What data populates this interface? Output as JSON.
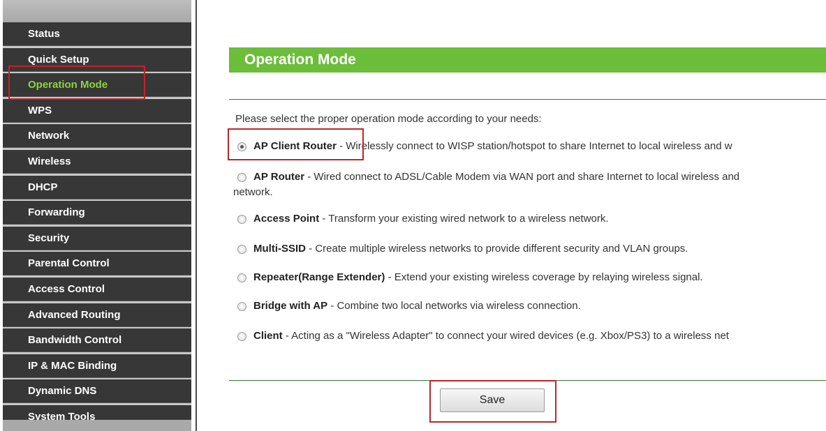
{
  "sidebar": {
    "items": [
      {
        "label": "Status"
      },
      {
        "label": "Quick Setup"
      },
      {
        "label": "Operation Mode"
      },
      {
        "label": "WPS"
      },
      {
        "label": "Network"
      },
      {
        "label": "Wireless"
      },
      {
        "label": "DHCP"
      },
      {
        "label": "Forwarding"
      },
      {
        "label": "Security"
      },
      {
        "label": "Parental Control"
      },
      {
        "label": "Access Control"
      },
      {
        "label": "Advanced Routing"
      },
      {
        "label": "Bandwidth Control"
      },
      {
        "label": "IP & MAC Binding"
      },
      {
        "label": "Dynamic DNS"
      },
      {
        "label": "System Tools"
      }
    ],
    "active_index": 2
  },
  "main": {
    "title": "Operation Mode",
    "intro": "Please select the proper operation mode according to your needs:",
    "options": [
      {
        "name": "AP Client Router",
        "desc": " - Wirelessly connect to WISP station/hotspot to share Internet to local wireless and w",
        "checked": true
      },
      {
        "name": "AP Router",
        "desc": " - Wired connect to ADSL/Cable Modem via WAN port and share Internet to local wireless and",
        "checked": false
      },
      {
        "name": "Access Point",
        "desc": " - Transform your existing wired network to a wireless network.",
        "checked": false
      },
      {
        "name": "Multi-SSID",
        "desc": " - Create multiple wireless networks to provide different security and VLAN groups.",
        "checked": false
      },
      {
        "name": "Repeater(Range Extender)",
        "desc": " - Extend your existing wireless coverage by relaying wireless signal.",
        "checked": false
      },
      {
        "name": "Bridge with AP",
        "desc": " - Combine two local networks via wireless connection.",
        "checked": false
      },
      {
        "name": "Client",
        "desc": " - Acting as a \"Wireless Adapter\" to connect your wired devices (e.g. Xbox/PS3) to a wireless net",
        "checked": false
      }
    ],
    "wrap_text": "network.",
    "save_label": "Save"
  },
  "colors": {
    "header_green": "#6bbd3a",
    "sidebar_bg": "#373737",
    "active_text": "#8bd63a",
    "highlight_red": "#c0242a"
  }
}
